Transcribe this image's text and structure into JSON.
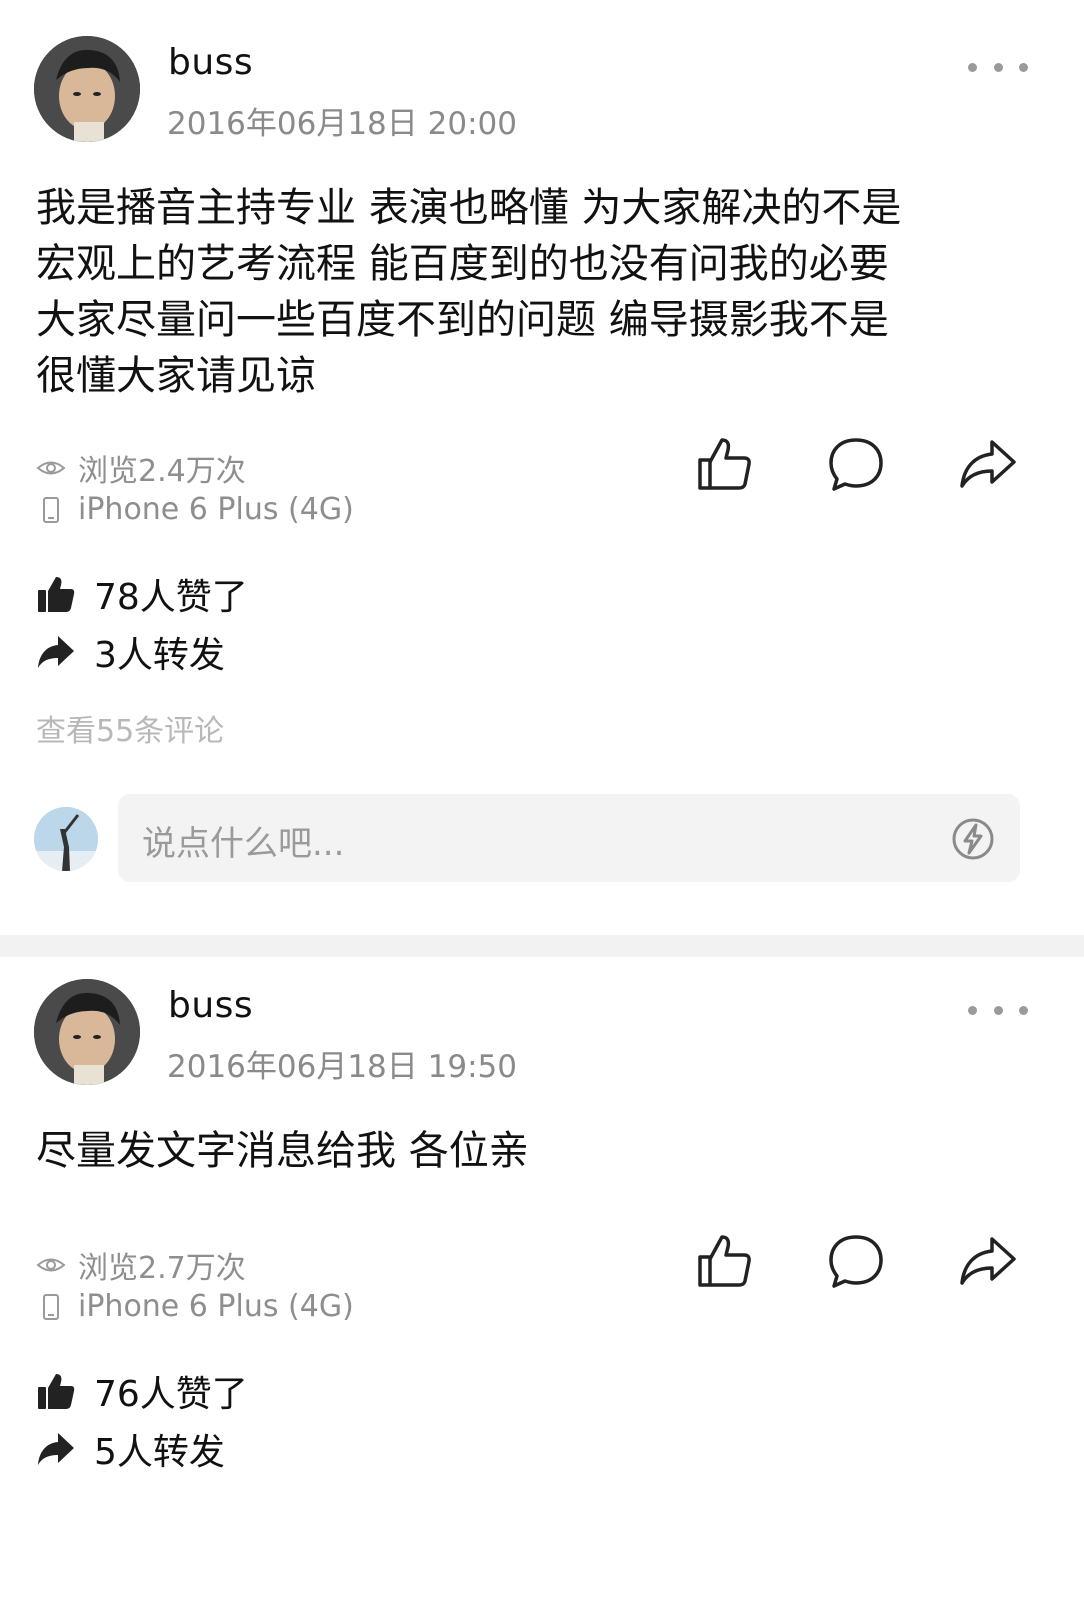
{
  "posts": [
    {
      "username": "buss",
      "timestamp": "2016年06月18日 20:00",
      "content_lines": [
        "我是播音主持专业 表演也略懂 为大家解决的不是",
        "宏观上的艺考流程 能百度到的也没有问我的必要",
        "大家尽量问一些百度不到的问题 编导摄影我不是",
        "很懂大家请见谅"
      ],
      "views": "浏览2.4万次",
      "device": "iPhone 6 Plus (4G)",
      "likes": "78人赞了",
      "reposts": "3人转发",
      "view_comments": "查看55条评论"
    },
    {
      "username": "buss",
      "timestamp": "2016年06月18日 19:50",
      "content_lines": [
        "尽量发文字消息给我 各位亲"
      ],
      "views": "浏览2.7万次",
      "device": "iPhone 6 Plus (4G)",
      "likes": "76人赞了",
      "reposts": "5人转发"
    }
  ],
  "comment_box": {
    "placeholder": "说点什么吧..."
  },
  "icons": {
    "more": "more-dots-icon",
    "eye": "eye-icon",
    "phone": "phone-icon",
    "like": "thumbs-up-icon",
    "comment": "comment-bubble-icon",
    "share": "share-arrow-icon",
    "bolt": "lightning-icon"
  }
}
